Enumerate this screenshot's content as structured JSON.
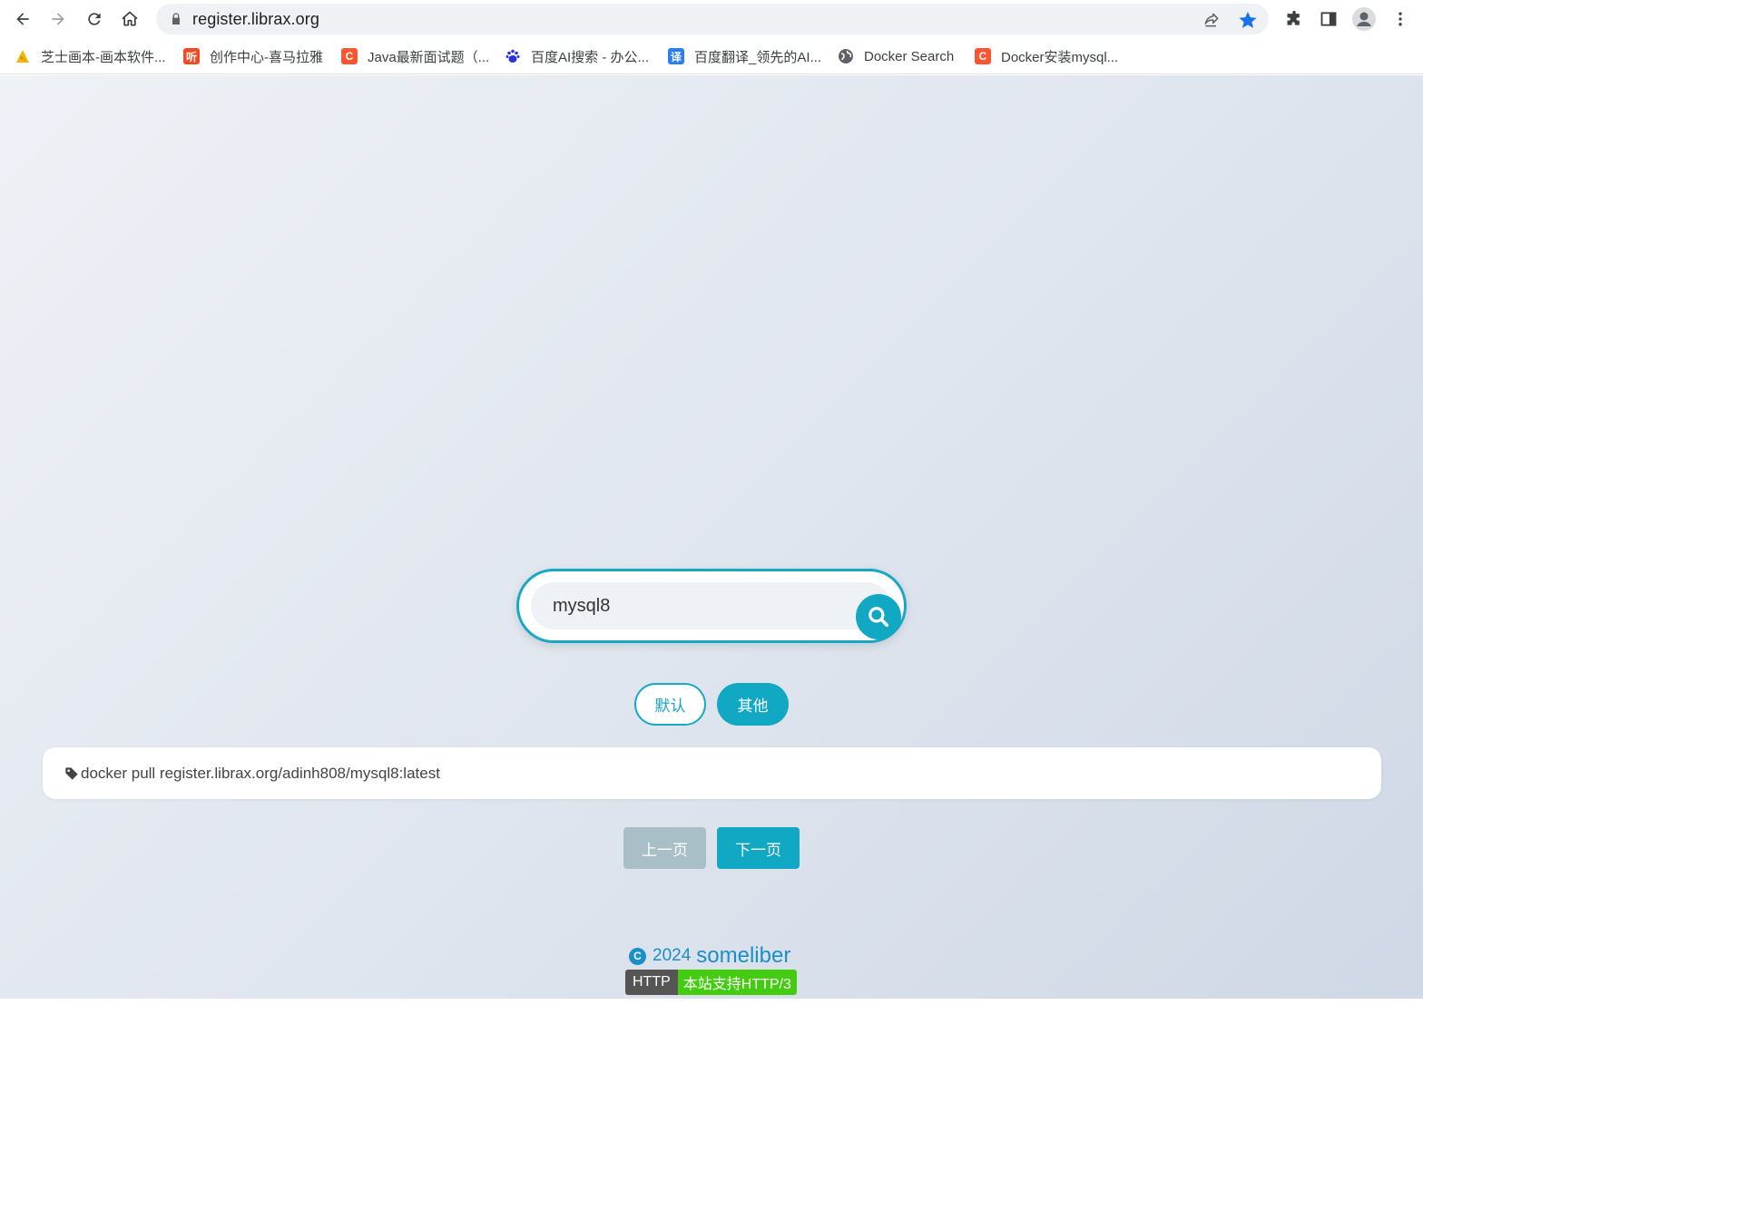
{
  "browser": {
    "url": "register.librax.org",
    "bookmarks": [
      {
        "label": "芝士画本-画本软件...",
        "icon": "cheese-icon",
        "color": "#f5b800"
      },
      {
        "label": "创作中心-喜马拉雅",
        "icon": "ximalaya-icon",
        "color": "#f24a24",
        "glyph": "听"
      },
      {
        "label": "Java最新面试题（...",
        "icon": "csdn-icon",
        "color": "#fc5531",
        "glyph": "C"
      },
      {
        "label": "百度AI搜索 - 办公...",
        "icon": "baidu-paw-icon",
        "color": "#2932e1"
      },
      {
        "label": "百度翻译_领先的AI...",
        "icon": "baidu-translate-icon",
        "color": "#2b7ef5",
        "glyph": "译"
      },
      {
        "label": "Docker Search",
        "icon": "globe-icon",
        "color": "#5f6368"
      },
      {
        "label": "Docker安装mysql...",
        "icon": "csdn-icon",
        "color": "#fc5531",
        "glyph": "C"
      }
    ]
  },
  "search": {
    "value": "mysql8"
  },
  "toggles": {
    "default_label": "默认",
    "other_label": "其他"
  },
  "result": {
    "command": "docker pull register.librax.org/adinh808/mysql8:latest"
  },
  "pager": {
    "prev_label": "上一页",
    "next_label": "下一页"
  },
  "footer": {
    "copyright_mark": "C",
    "year": "2024",
    "name": "someliber",
    "badge_left": "HTTP",
    "badge_right": "本站支持HTTP/3"
  },
  "colors": {
    "accent": "#11a8c4",
    "prev_disabled": "#a8bfc7",
    "footer_link": "#1a8fc9",
    "badge_green": "#44cc11"
  }
}
